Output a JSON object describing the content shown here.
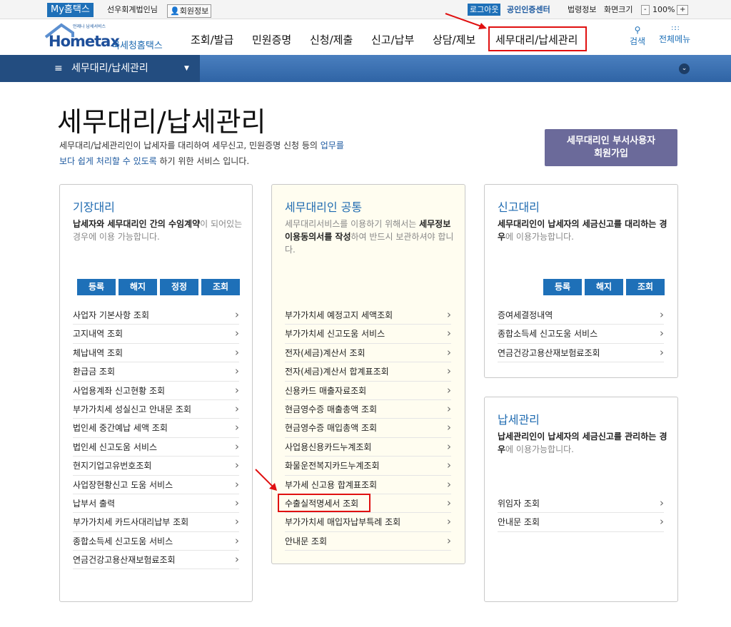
{
  "topbar": {
    "my": "My홈택스",
    "user": "선우회계법인님",
    "member": "회원정보",
    "logout": "로그아웃",
    "cert": "공인인증센터",
    "law": "법령정보",
    "screen": "화면크기",
    "zoom": "100%",
    "minus": "-",
    "plus": "+"
  },
  "header": {
    "logo_small": "언제나 납세서비스",
    "logo": "Hometax",
    "logo_kr": "국세청홈택스",
    "nav": [
      "조회/발급",
      "민원증명",
      "신청/제출",
      "신고/납부",
      "상담/제보",
      "세무대리/납세관리"
    ],
    "search": "검색",
    "menu": "전체메뉴"
  },
  "breadcrumb": {
    "label": "세무대리/납세관리"
  },
  "page": {
    "title": "세무대리/납세관리",
    "intro1a": "세무대리/납세관리인이 납세자를 대리하여 세무신고, 민원증명 신청 등의 ",
    "intro1b": "업무를",
    "intro2a": "보다 쉽게 처리할 수 있도록",
    "intro2b": " 하기 위한 서비스 입니다.",
    "join": "세무대리인 부서사용자 회원가입"
  },
  "cards": [
    {
      "title": "기장대리",
      "desc_b": "납세자와 세무대리인 간의 수임계약",
      "desc": "이 되어있는 경우에 이용 가능합니다.",
      "buttons": [
        "등록",
        "해지",
        "정정",
        "조회"
      ],
      "items": [
        "사업자 기본사항 조회",
        "고지내역 조회",
        "체납내역 조회",
        "환급금 조회",
        "사업용계좌 신고현황 조회",
        "부가가치세 성실신고 안내문 조회",
        "법인세 중간예납 세액 조회",
        "법인세 신고도움 서비스",
        "현지기업고유번호조회",
        "사업장현황신고 도움 서비스",
        "납부서 출력",
        "부가가치세 카드사대리납부 조회",
        "종합소득세 신고도움 서비스",
        "연금건강고용산재보험료조회"
      ]
    },
    {
      "title": "세무대리인 공통",
      "desc1": "세무대리서비스를 이용하기 위해서는 ",
      "desc_b": "세무정보이용동의서를 작성",
      "desc2": "하여 반드시 보관하셔야 합니다.",
      "items": [
        "부가가치세 예정고지 세액조회",
        "부가가치세 신고도움 서비스",
        "전자(세금)계산서 조회",
        "전자(세금)계산서 합계표조회",
        "신용카드 매출자료조회",
        "현금영수증 매출총액 조회",
        "현금영수증 매입총액 조회",
        "사업용신용카드누계조회",
        "화물운전복지카드누계조회",
        "부가세 신고용 합계표조회",
        "수출실적명세서 조회",
        "부가가치세 매입자납부특례 조회",
        "안내문 조회"
      ]
    },
    {
      "title": "신고대리",
      "desc_b": "세무대리인이 납세자의 세금신고를 대리하는 경우",
      "desc": "에 이용가능합니다.",
      "buttons": [
        "등록",
        "해지",
        "조회"
      ],
      "items": [
        "증여세결정내역",
        "종합소득세 신고도움 서비스",
        "연금건강고용산재보험료조회"
      ]
    },
    {
      "title": "납세관리",
      "desc_b": "납세관리인이 납세자의 세금신고를 관리하는 경우",
      "desc": "에 이용가능합니다.",
      "items": [
        "위임자 조회",
        "안내문 조회"
      ]
    }
  ]
}
